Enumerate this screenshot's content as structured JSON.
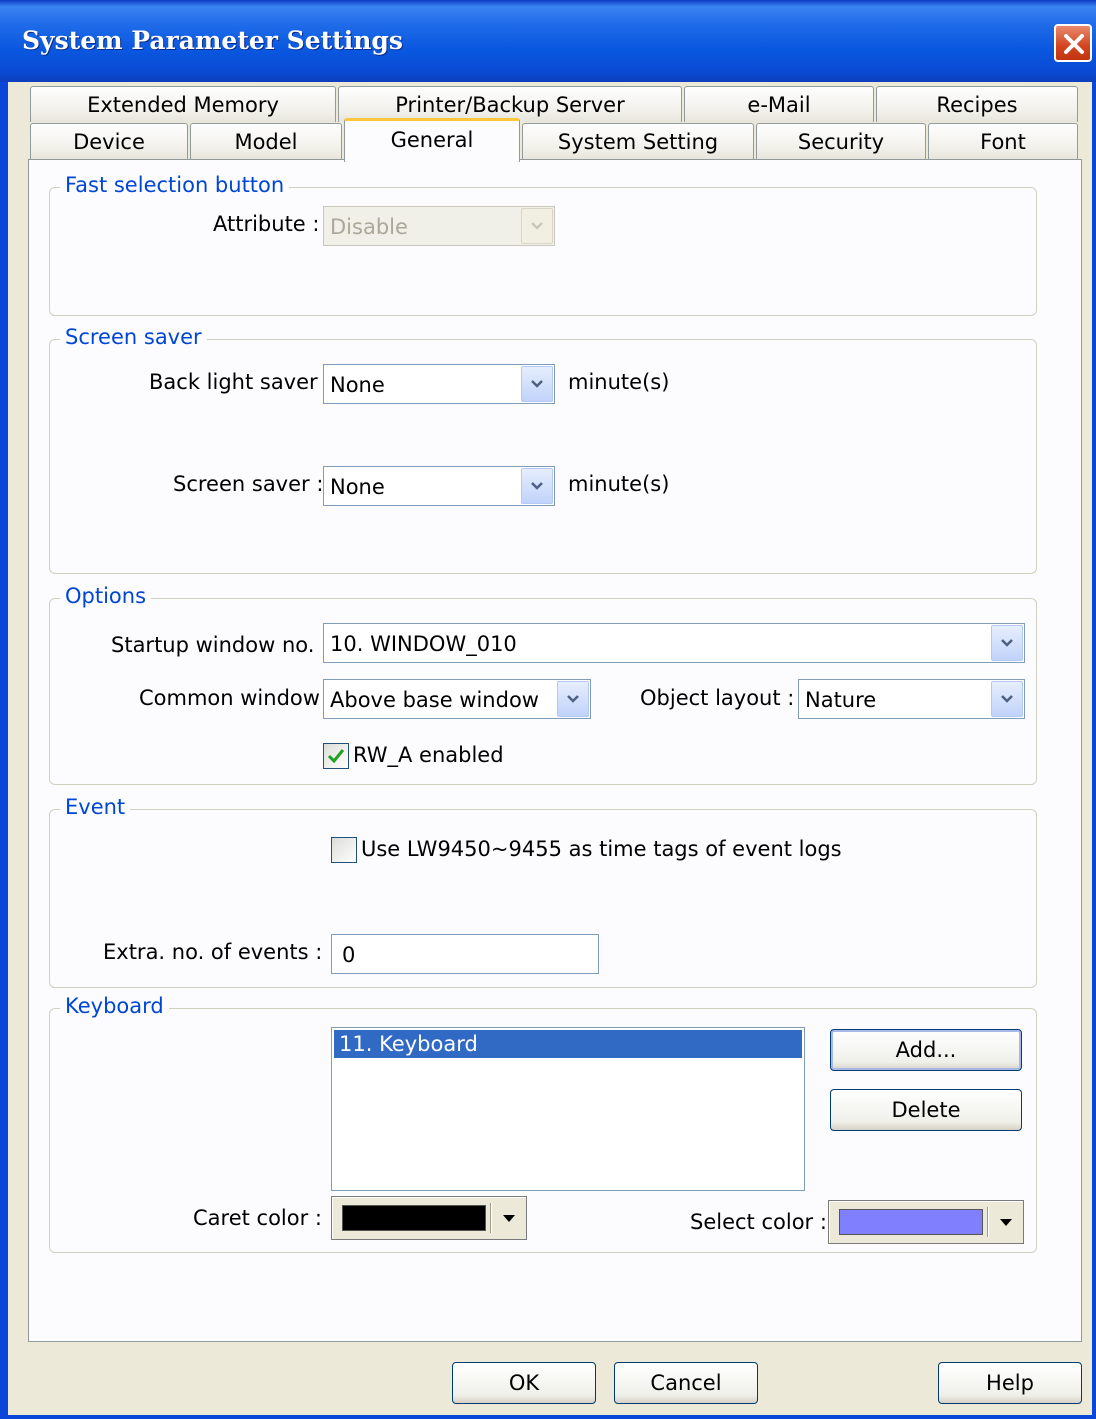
{
  "window": {
    "title": "System Parameter Settings"
  },
  "tabs": {
    "row1": [
      "Extended Memory",
      "Printer/Backup Server",
      "e-Mail",
      "Recipes"
    ],
    "row2": [
      "Device",
      "Model",
      "General",
      "System Setting",
      "Security",
      "Font"
    ],
    "active": "General"
  },
  "fast_selection": {
    "title": "Fast selection button",
    "attribute_label": "Attribute :",
    "attribute_value": "Disable"
  },
  "screen_saver": {
    "title": "Screen saver",
    "backlight_label": "Back light saver :",
    "backlight_value": "None",
    "screensaver_label": "Screen saver :",
    "screensaver_value": "None",
    "unit": "minute(s)"
  },
  "options": {
    "title": "Options",
    "startup_label": "Startup window no. :",
    "startup_value": "10. WINDOW_010",
    "common_label": "Common window :",
    "common_value": "Above base window",
    "layout_label": "Object layout :",
    "layout_value": "Nature",
    "rwa_label": "RW_A enabled",
    "rwa_checked": true
  },
  "event": {
    "title": "Event",
    "timetag_label": "Use LW9450~9455 as time tags of event logs",
    "timetag_checked": false,
    "extra_label": "Extra. no. of events :",
    "extra_value": "0"
  },
  "keyboard": {
    "title": "Keyboard",
    "items": [
      "11. Keyboard"
    ],
    "add_label": "Add...",
    "delete_label": "Delete",
    "caret_label": "Caret color :",
    "caret_color": "#000000",
    "select_label": "Select color :",
    "select_color": "#8080ff"
  },
  "footer": {
    "ok": "OK",
    "cancel": "Cancel",
    "help": "Help"
  },
  "colors": {
    "titlebar": "#0a58e0",
    "group_title": "#0046d5",
    "selection": "#316ac5",
    "active_tab_accent": "#ffc83c"
  }
}
